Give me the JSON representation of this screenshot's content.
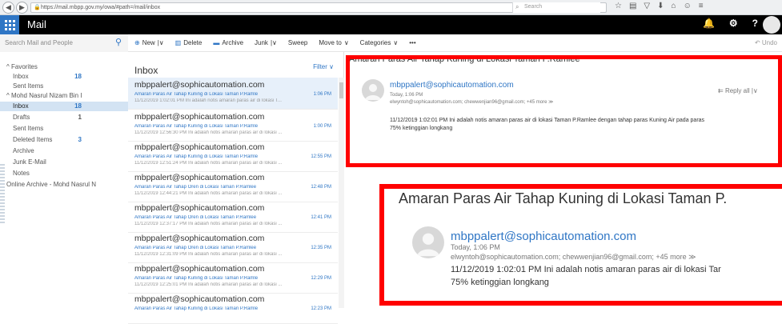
{
  "browser": {
    "url": "https://mail.mbpp.gov.my/owa/#path=/mail/inbox",
    "search_placeholder": "Search"
  },
  "app": {
    "name": "Mail"
  },
  "commands": {
    "search_placeholder": "Search Mail and People",
    "new": "New",
    "delete": "Delete",
    "archive": "Archive",
    "junk": "Junk",
    "sweep": "Sweep",
    "move_to": "Move to",
    "categories": "Categories",
    "more": "•••",
    "undo": "Undo"
  },
  "folders": {
    "favorites_header": "Favorites",
    "favorites": [
      {
        "label": "Inbox",
        "count": "18"
      },
      {
        "label": "Sent Items",
        "count": ""
      }
    ],
    "account": "Mohd Nasrul Nizam Bin I",
    "items": [
      {
        "label": "Inbox",
        "count": "18"
      },
      {
        "label": "Drafts",
        "count": "1"
      },
      {
        "label": "Sent Items",
        "count": ""
      },
      {
        "label": "Deleted Items",
        "count": "3"
      },
      {
        "label": "Archive",
        "count": ""
      },
      {
        "label": "Junk E-Mail",
        "count": ""
      },
      {
        "label": "Notes",
        "count": ""
      }
    ],
    "online_archive": "Online Archive - Mohd Nasrul N"
  },
  "list": {
    "title": "Inbox",
    "filter": "Filter",
    "messages": [
      {
        "from": "mbppalert@sophicautomation.com",
        "subject": "Amaran Paras Air Tahap Kuning di Lokasi Taman P.Ramle",
        "time": "1:06 PM",
        "preview": "11/12/2019 1:02:01 PM Ini adalah notis amaran paras air di lokasi T..."
      },
      {
        "from": "mbppalert@sophicautomation.com",
        "subject": "Amaran Paras Air Tahap Kuning di Lokasi Taman P.Ramle",
        "time": "1:00 PM",
        "preview": "11/12/2019 12:56:30 PM Ini adalah notis amaran paras air di lokasi ..."
      },
      {
        "from": "mbppalert@sophicautomation.com",
        "subject": "Amaran Paras Air Tahap Kuning di Lokasi Taman P.Ramle",
        "time": "12:55 PM",
        "preview": "11/12/2019 12:51:24 PM Ini adalah notis amaran paras air di lokasi ..."
      },
      {
        "from": "mbppalert@sophicautomation.com",
        "subject": "Amaran Paras Air Tahap Oren di Lokasi Taman P.Ramlee",
        "time": "12:48 PM",
        "preview": "11/12/2019 12:44:21 PM Ini adalah notis amaran paras air di lokasi ..."
      },
      {
        "from": "mbppalert@sophicautomation.com",
        "subject": "Amaran Paras Air Tahap Oren di Lokasi Taman P.Ramlee",
        "time": "12:41 PM",
        "preview": "11/12/2019 12:37:17 PM Ini adalah notis amaran paras air di lokasi ..."
      },
      {
        "from": "mbppalert@sophicautomation.com",
        "subject": "Amaran Paras Air Tahap Oren di Lokasi Taman P.Ramlee",
        "time": "12:35 PM",
        "preview": "11/12/2019 12:31:09 PM Ini adalah notis amaran paras air di lokasi ..."
      },
      {
        "from": "mbppalert@sophicautomation.com",
        "subject": "Amaran Paras Air Tahap Kuning di Lokasi Taman P.Ramle",
        "time": "12:29 PM",
        "preview": "11/12/2019 12:25:01 PM Ini adalah notis amaran paras air di lokasi ..."
      },
      {
        "from": "mbppalert@sophicautomation.com",
        "subject": "Amaran Paras Air Tahap Kuning di Lokasi Taman P.Ramle",
        "time": "12:23 PM",
        "preview": ""
      }
    ]
  },
  "reading": {
    "title": "Amaran Paras Air Tahap Kuning di Lokasi Taman P.Ramlee",
    "from": "mbppalert@sophicautomation.com",
    "date": "Today, 1:06 PM",
    "to": "elwyntoh@sophicautomation.com; chewwenjian96@gmail.com; +45 more ≫",
    "reply_all": "Reply all",
    "body_line1": "11/12/2019 1:02:01 PM Ini adalah notis amaran paras air di lokasi  Taman P.Ramlee dengan tahap paras Kuning Air pada paras",
    "body_line2": "75% ketinggian longkang"
  },
  "zoom": {
    "title": "Amaran Paras Air Tahap Kuning di Lokasi Taman P.",
    "from": "mbppalert@sophicautomation.com",
    "date": "Today, 1:06 PM",
    "to": "elwyntoh@sophicautomation.com; chewwenjian96@gmail.com; +45 more ≫",
    "body_line1": "11/12/2019 1:02:01 PM Ini adalah notis amaran paras air di lokasi  Tar",
    "body_line2": "75% ketinggian longkang"
  },
  "colors": {
    "accent": "#2f76c5",
    "highlight": "#ff0000",
    "appbar": "#000000"
  },
  "icons": [
    "back-icon",
    "forward-icon",
    "lock-icon",
    "reload-icon",
    "star-icon",
    "home-icon",
    "waffle-icon",
    "bell-icon",
    "gear-icon",
    "help-icon",
    "search-icon"
  ]
}
